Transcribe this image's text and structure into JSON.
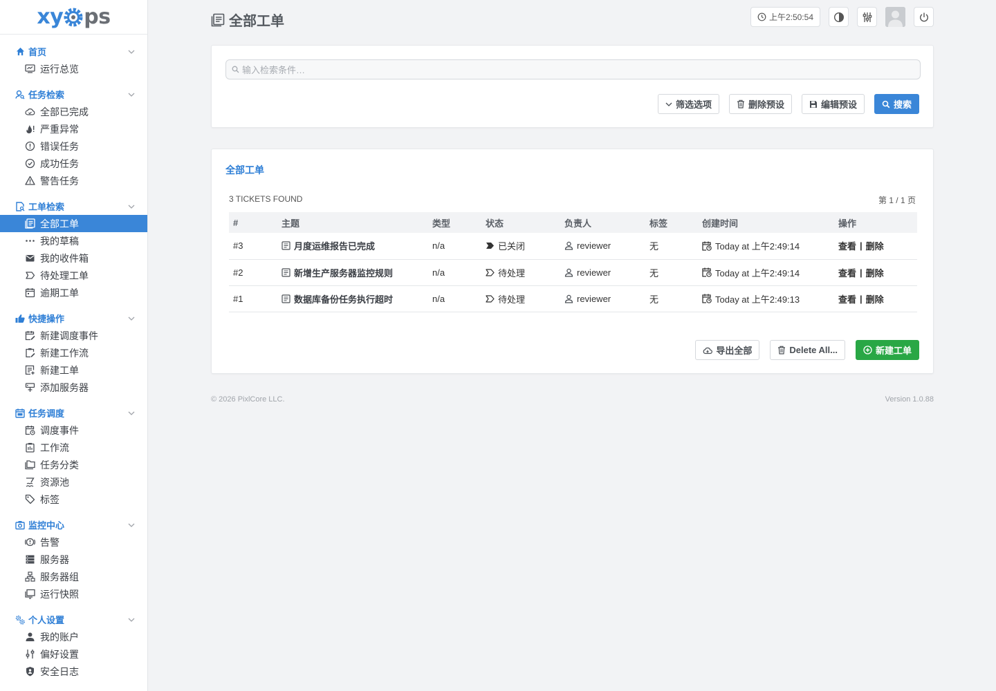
{
  "logo": {
    "part1": "xy",
    "part2": "ps"
  },
  "nav": [
    {
      "title": "首页",
      "items": [
        "运行总览"
      ]
    },
    {
      "title": "任务检索",
      "items": [
        "全部已完成",
        "严重异常",
        "错误任务",
        "成功任务",
        "警告任务"
      ]
    },
    {
      "title": "工单检索",
      "items": [
        "全部工单",
        "我的草稿",
        "我的收件箱",
        "待处理工单",
        "逾期工单"
      ]
    },
    {
      "title": "快捷操作",
      "items": [
        "新建调度事件",
        "新建工作流",
        "新建工单",
        "添加服务器"
      ]
    },
    {
      "title": "任务调度",
      "items": [
        "调度事件",
        "工作流",
        "任务分类",
        "资源池",
        "标签"
      ]
    },
    {
      "title": "监控中心",
      "items": [
        "告警",
        "服务器",
        "服务器组",
        "运行快照"
      ]
    },
    {
      "title": "个人设置",
      "items": [
        "我的账户",
        "偏好设置",
        "安全日志"
      ]
    }
  ],
  "header": {
    "title": "全部工单",
    "clock": "上午2:50:54"
  },
  "search": {
    "placeholder": "输入检索条件…",
    "filter_label": "筛选选项",
    "delete_preset_label": "删除预设",
    "edit_preset_label": "编辑预设",
    "search_label": "搜索"
  },
  "list": {
    "title": "全部工单",
    "found": "3 TICKETS FOUND",
    "pager": "第 1 / 1 页",
    "columns": [
      "#",
      "主题",
      "类型",
      "状态",
      "负责人",
      "标签",
      "创建时间",
      "操作"
    ],
    "rows": [
      {
        "num": "#3",
        "subject": "月度运维报告已完成",
        "type": "n/a",
        "status": "已关闭",
        "assignee": "reviewer",
        "tags": "无",
        "created": "Today at 上午2:49:14",
        "view": "查看",
        "sep": "|",
        "del": "删除"
      },
      {
        "num": "#2",
        "subject": "新增生产服务器监控规则",
        "type": "n/a",
        "status": "待处理",
        "assignee": "reviewer",
        "tags": "无",
        "created": "Today at 上午2:49:14",
        "view": "查看",
        "sep": "|",
        "del": "删除"
      },
      {
        "num": "#1",
        "subject": "数据库备份任务执行超时",
        "type": "n/a",
        "status": "待处理",
        "assignee": "reviewer",
        "tags": "无",
        "created": "Today at 上午2:49:13",
        "view": "查看",
        "sep": "|",
        "del": "删除"
      }
    ],
    "export_label": "导出全部",
    "delete_all_label": "Delete All...",
    "new_label": "新建工单"
  },
  "footer": {
    "copyright": "© 2026 PixlCore LLC.",
    "version": "Version 1.0.88"
  },
  "colors": {
    "accent": "#3a86d8",
    "success": "#29a745"
  }
}
